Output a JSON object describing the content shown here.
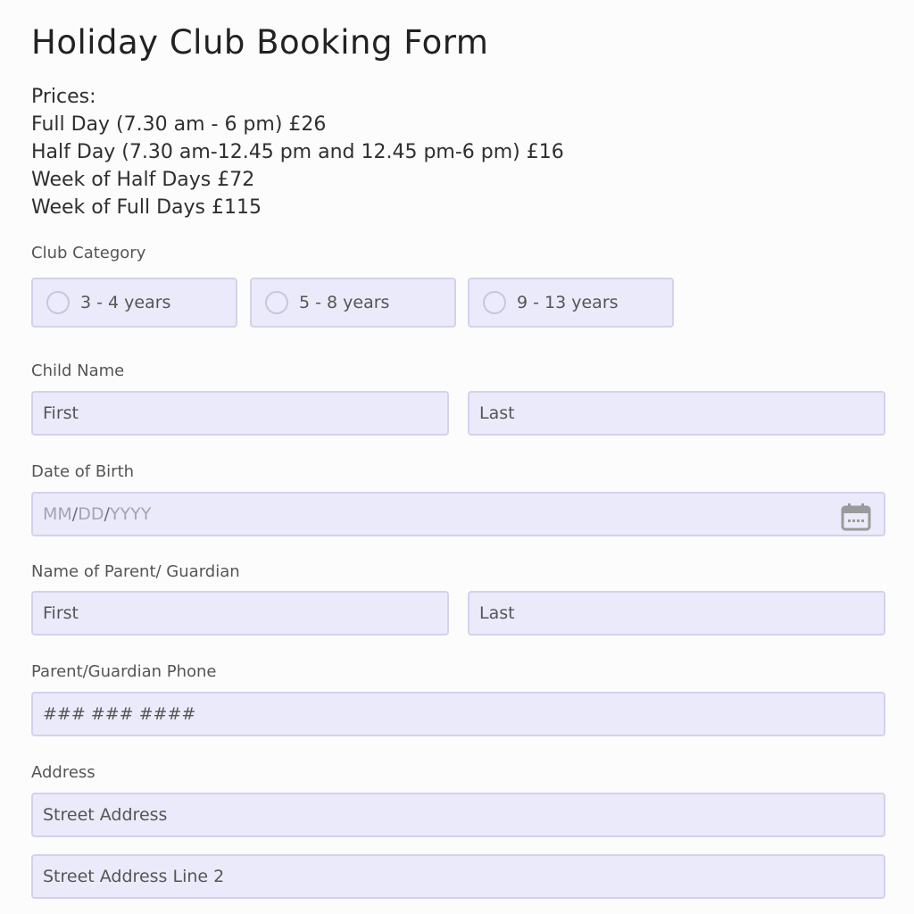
{
  "form": {
    "title": "Holiday Club Booking Form",
    "prices": [
      "Prices:",
      "Full Day (7.30 am - 6 pm) £26",
      "Half Day (7.30 am-12.45 pm and 12.45 pm-6 pm) £16",
      "Week of Half Days £72",
      "Week of Full Days £115"
    ]
  },
  "club_category": {
    "label": "Club Category",
    "options": [
      "3 - 4 years",
      "5 - 8 years",
      "9 - 13 years"
    ]
  },
  "child_name": {
    "label": "Child Name",
    "first_placeholder": "First",
    "last_placeholder": "Last"
  },
  "dob": {
    "label": "Date of Birth",
    "mm": "MM",
    "dd": "DD",
    "yyyy": "YYYY",
    "separator": "/",
    "icon": "calendar-icon"
  },
  "parent_name": {
    "label": "Name of Parent/ Guardian",
    "first_placeholder": "First",
    "last_placeholder": "Last"
  },
  "phone": {
    "label": "Parent/Guardian Phone",
    "placeholder": "### ### ####"
  },
  "address": {
    "label": "Address",
    "line1_placeholder": "Street Address",
    "line2_placeholder": "Street Address Line 2"
  },
  "colors": {
    "field_bg": "#ebeafb",
    "field_border": "#d3d2ec",
    "page_bg": "#fcfcfc"
  }
}
